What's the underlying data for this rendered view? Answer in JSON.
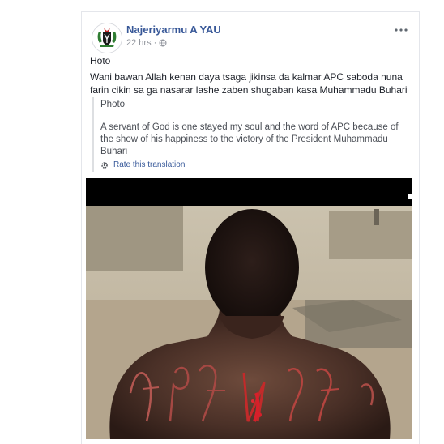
{
  "post": {
    "author": "Najeriyarmu A YAU",
    "time": "22 hrs",
    "visibility_icon": "globe-icon",
    "more_icon": "ellipsis-icon",
    "title": "Hoto",
    "body_line1": "Wani bawan Allah kenan daya tsaga jikinsa da kalmar APC saboda nuna",
    "body_line2": "farin cikin sa ga nasarar lashe zaben shugaban kasa Muhammadu Buhari"
  },
  "translation": {
    "title": "Photo",
    "line1": "A servant of God is one stayed my soul and the word of APC because of",
    "line2": "the show of his happiness to the victory of the President Muhammadu",
    "line3": "Buhari",
    "rate_label": "Rate this translation",
    "rate_icon": "gear-icon"
  },
  "colors": {
    "link": "#385898",
    "meta": "#90949c",
    "border": "#dddfe2"
  }
}
